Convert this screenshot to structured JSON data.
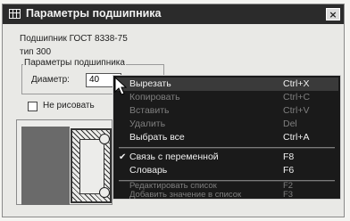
{
  "window": {
    "title": "Параметры подшипника",
    "close_glyph": "×"
  },
  "info": {
    "bearing_standard": "Подшипник ГОСТ 8338-75",
    "type": "тип 300"
  },
  "group": {
    "title": "Параметры подшипника",
    "diameter_label": "Диаметр:",
    "diameter_value": "40"
  },
  "options": {
    "no_draw_label": "Не рисовать"
  },
  "context_menu": {
    "items": [
      {
        "label": "Вырезать",
        "shortcut": "Ctrl+X",
        "enabled": true
      },
      {
        "label": "Копировать",
        "shortcut": "Ctrl+C",
        "enabled": false
      },
      {
        "label": "Вставить",
        "shortcut": "Ctrl+V",
        "enabled": false
      },
      {
        "label": "Удалить",
        "shortcut": "Del",
        "enabled": false
      },
      {
        "label": "Выбрать все",
        "shortcut": "Ctrl+A",
        "enabled": true
      },
      {
        "label": "Связь с переменной",
        "shortcut": "F8",
        "enabled": true,
        "checked": true
      },
      {
        "label": "Словарь",
        "shortcut": "F6",
        "enabled": true
      },
      {
        "label": "Редактировать список",
        "shortcut": "F2",
        "enabled": false
      },
      {
        "label": "Добавить значение в список",
        "shortcut": "F3",
        "enabled": false
      }
    ],
    "check_glyph": "✔"
  },
  "colors": {
    "titlebar": "#2b2b2b",
    "menu_bg": "#1a1a1a",
    "disabled_text": "#7f7f7f"
  },
  "icons": {
    "window": "table-grid-icon",
    "cursor": "arrow-cursor-icon"
  }
}
